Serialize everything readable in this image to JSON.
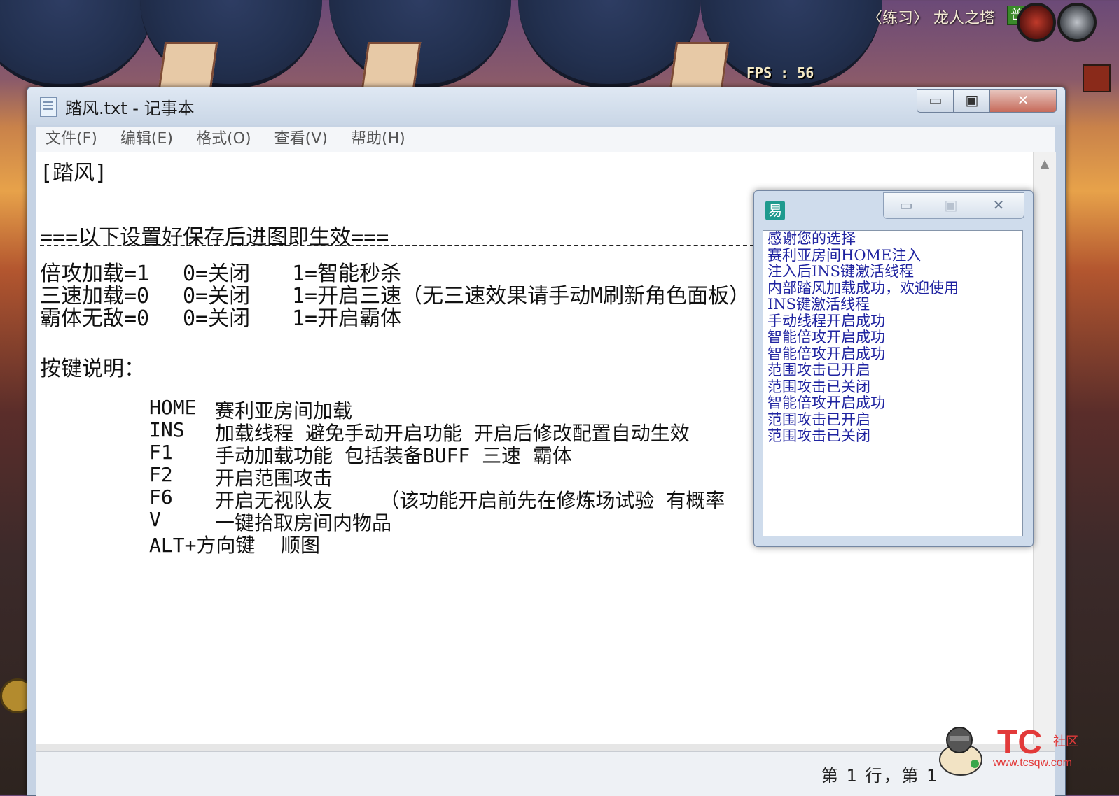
{
  "game_hud": {
    "location_title": "〈练习〉 龙人之塔",
    "mode_badge": "普",
    "fps": "FPS : 56"
  },
  "notepad": {
    "title": "踏风.txt - 记事本",
    "window_buttons": {
      "minimize": "▭",
      "maximize": "▣",
      "close": "✕"
    },
    "menu": [
      "文件(F)",
      "编辑(E)",
      "格式(O)",
      "查看(V)",
      "帮助(H)"
    ],
    "content": {
      "section": "[踏风]",
      "notice": "===以下设置好保存后进图即生效===",
      "settings": [
        {
          "key": "倍攻加载=1",
          "off": "0=关闭",
          "on": "1=智能秒杀"
        },
        {
          "key": "三速加载=0",
          "off": "0=关闭",
          "on": "1=开启三速（无三速效果请手动M刷新角色面板）"
        },
        {
          "key": "霸体无敌=0",
          "off": "0=关闭",
          "on": "1=开启霸体"
        }
      ],
      "keys_heading": "按键说明：",
      "keys": [
        {
          "key": "HOME",
          "desc": "赛利亚房间加载"
        },
        {
          "key": "INS",
          "desc": "加载线程 避免手动开启功能 开启后修改配置自动生效"
        },
        {
          "key": "F1",
          "desc": "手动加载功能 包括装备BUFF 三速 霸体"
        },
        {
          "key": "F2",
          "desc": "开启范围攻击"
        },
        {
          "key": "F6",
          "desc": "开启无视队友    （该功能开启前先在修炼场试验 有概率"
        },
        {
          "key": "V",
          "desc": "一键拾取房间内物品"
        },
        {
          "key": "ALT+方向键",
          "desc": "顺图"
        }
      ]
    },
    "status": "第 1 行，第 1"
  },
  "helper_window": {
    "icon_label": "易",
    "log": [
      "感谢您的选择",
      "赛利亚房间HOME注入",
      "注入后INS键激活线程",
      "内部踏风加载成功，欢迎使用",
      "INS键激活线程",
      "手动线程开启成功",
      "智能倍攻开启成功",
      "智能倍攻开启成功",
      "范围攻击已开启",
      "范围攻击已关闭",
      "智能倍攻开启成功",
      "范围攻击已开启",
      "范围攻击已关闭"
    ]
  },
  "watermark": {
    "brand": "TC",
    "sub": "社区",
    "url": "www.tcsqw.com"
  },
  "colors": {
    "log_text": "#1f23a0",
    "watermark": "#e23a3a"
  }
}
